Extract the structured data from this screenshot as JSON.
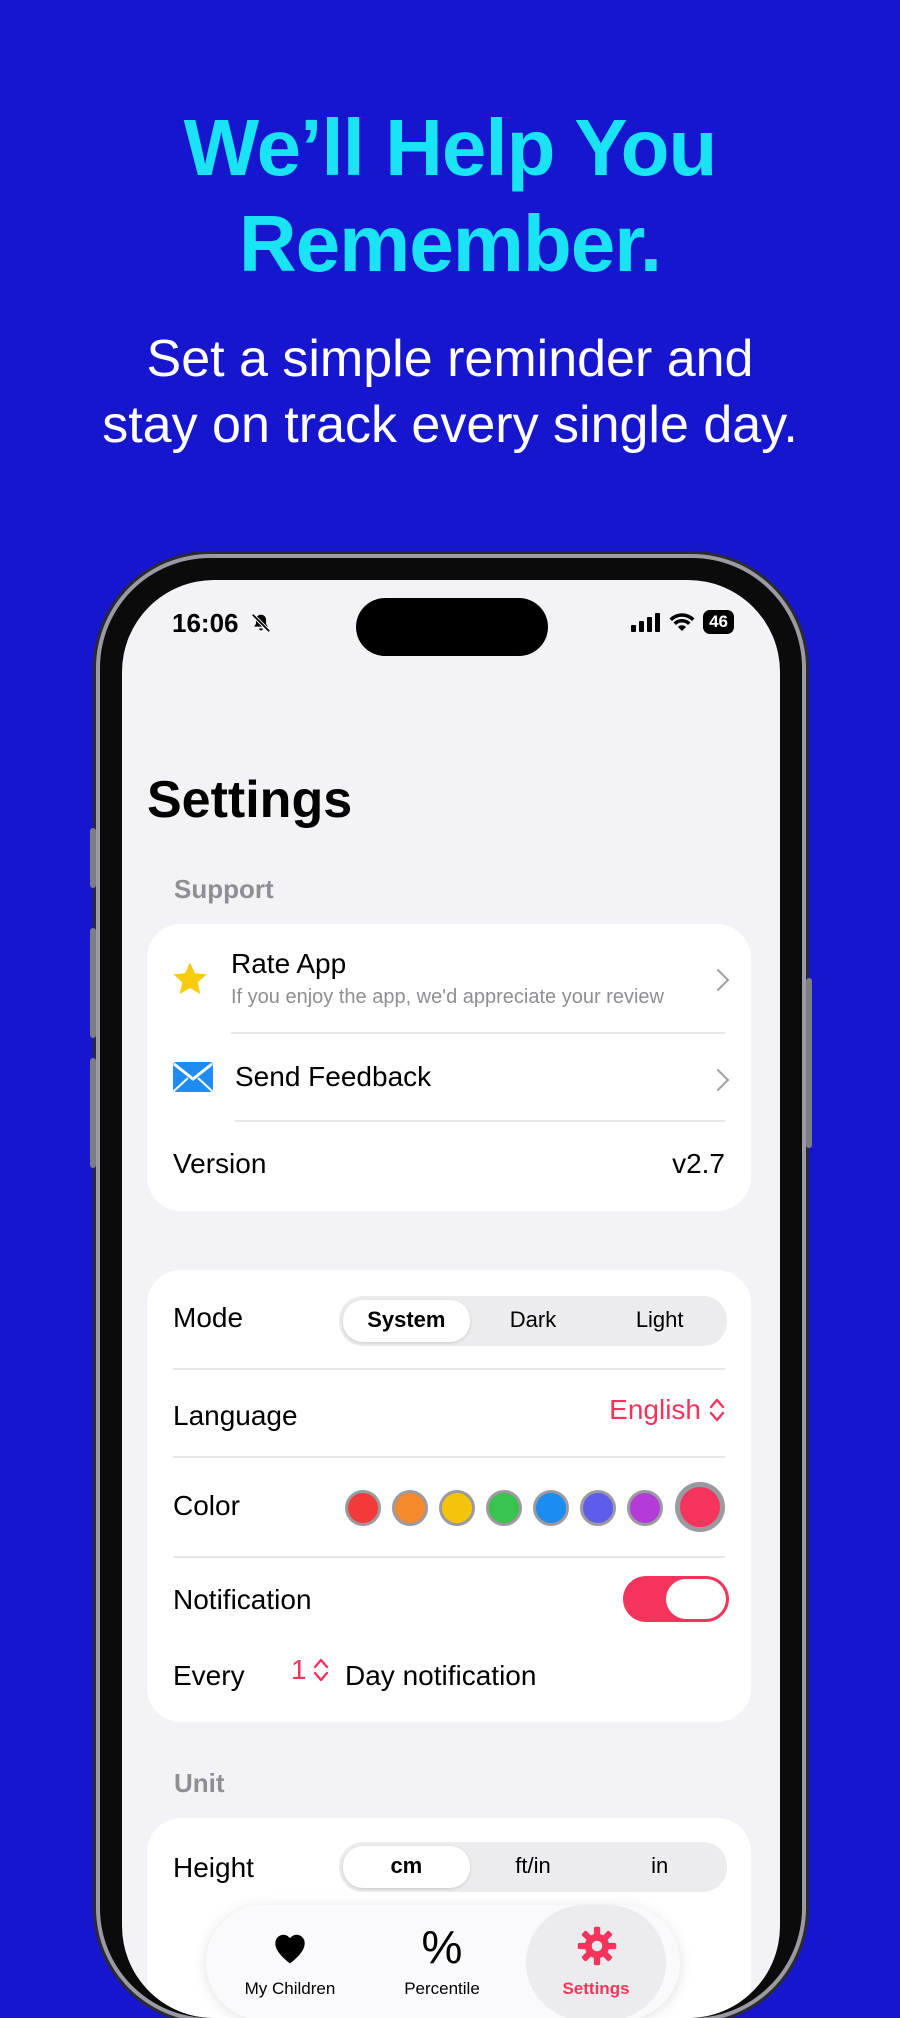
{
  "promo": {
    "headline_line1": "We’ll Help You",
    "headline_line2": "Remember.",
    "subhead_line1": "Set a simple reminder and",
    "subhead_line2": "stay on track every single day."
  },
  "status_bar": {
    "time": "16:06",
    "battery": "46"
  },
  "screen": {
    "title": "Settings"
  },
  "support": {
    "section_label": "Support",
    "rate_app": {
      "label": "Rate App",
      "subtitle": "If you enjoy the app, we'd appreciate your review",
      "icon": "star-icon"
    },
    "send_feedback": {
      "label": "Send Feedback",
      "icon": "envelope-icon"
    },
    "version": {
      "label": "Version",
      "value": "v2.7"
    }
  },
  "preferences": {
    "mode": {
      "label": "Mode",
      "options": [
        "System",
        "Dark",
        "Light"
      ],
      "selected": "System"
    },
    "language": {
      "label": "Language",
      "value": "English"
    },
    "color": {
      "label": "Color",
      "swatches": [
        "#F23A3A",
        "#F48A2C",
        "#F5C40A",
        "#38C24E",
        "#1A8CF2",
        "#5D5CEB",
        "#B43BD8",
        "#F4345A"
      ],
      "selected_index": 7
    },
    "notification": {
      "label": "Notification",
      "enabled": true
    },
    "every": {
      "label": "Every",
      "value": "1",
      "suffix": "Day notification"
    }
  },
  "unit": {
    "section_label": "Unit",
    "height": {
      "label": "Height",
      "options": [
        "cm",
        "ft/in",
        "in"
      ]
    }
  },
  "tabs": [
    {
      "label": "My Children",
      "icon": "heart-icon"
    },
    {
      "label": "Percentile",
      "icon": "percent-icon"
    },
    {
      "label": "Settings",
      "icon": "gear-icon",
      "active": true
    }
  ],
  "colors": {
    "accent": "#F4345A",
    "background": "#1616CF",
    "headline": "#19E3F5"
  }
}
